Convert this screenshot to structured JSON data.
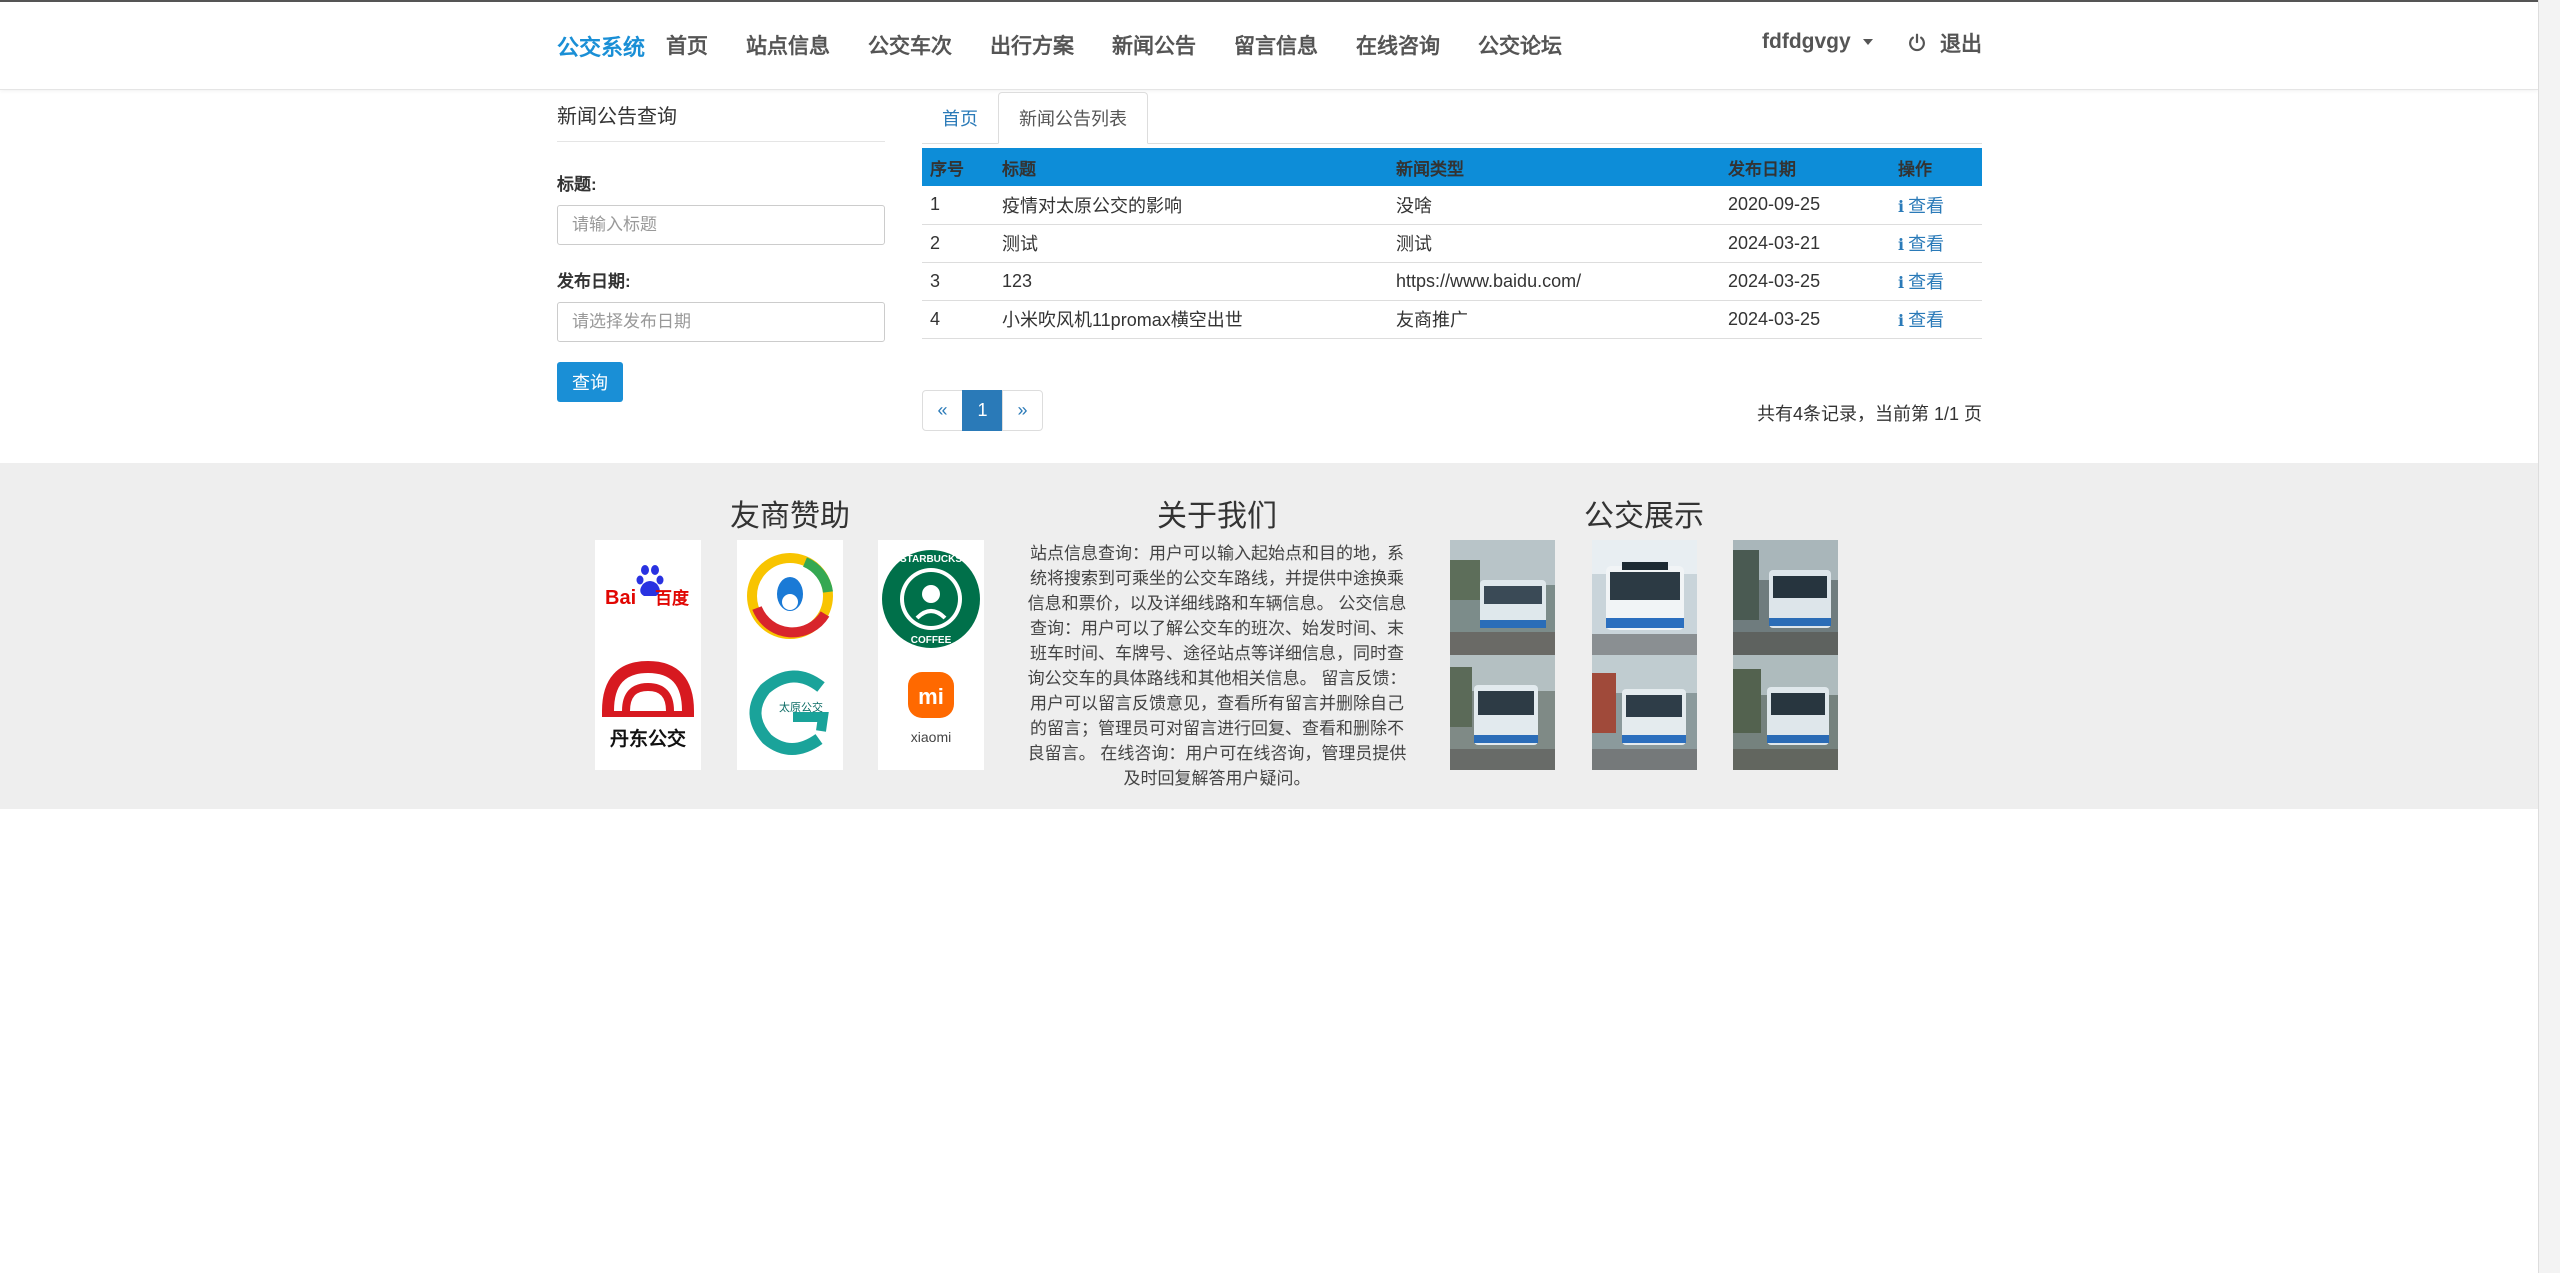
{
  "navbar": {
    "brand": "公交系统",
    "items": [
      "首页",
      "站点信息",
      "公交车次",
      "出行方案",
      "新闻公告",
      "留言信息",
      "在线咨询",
      "公交论坛"
    ],
    "username": "fdfdgvgy",
    "logout": "退出"
  },
  "search": {
    "title": "新闻公告查询",
    "title_label": "标题:",
    "title_placeholder": "请输入标题",
    "date_label": "发布日期:",
    "date_placeholder": "请选择发布日期",
    "button": "查询"
  },
  "tabs": {
    "home": "首页",
    "list": "新闻公告列表"
  },
  "table": {
    "headers": [
      "序号",
      "标题",
      "新闻类型",
      "发布日期",
      "操作"
    ],
    "view_label": "查看",
    "rows": [
      {
        "no": "1",
        "title": "疫情对太原公交的影响",
        "type": "没啥",
        "date": "2020-09-25"
      },
      {
        "no": "2",
        "title": "测试",
        "type": "测试",
        "date": "2024-03-21"
      },
      {
        "no": "3",
        "title": "123",
        "type": "https://www.baidu.com/",
        "date": "2024-03-25"
      },
      {
        "no": "4",
        "title": "小米吹风机11promax横空出世",
        "type": "友商推广",
        "date": "2024-03-25"
      }
    ]
  },
  "pagination": {
    "prev": "«",
    "current": "1",
    "next": "»",
    "info": "共有4条记录，当前第 1/1 页"
  },
  "footer": {
    "sponsors_title": "友商赞助",
    "about_title": "关于我们",
    "about_text": "站点信息查询：用户可以输入起始点和目的地，系统将搜索到可乘坐的公交车路线，并提供中途换乘信息和票价，以及详细线路和车辆信息。 公交信息查询：用户可以了解公交车的班次、始发时间、末班车时间、车牌号、途径站点等详细信息，同时查询公交车的具体路线和其他相关信息。 留言反馈：用户可以留言反馈意见，查看所有留言并删除自己的留言；管理员可对留言进行回复、查看和删除不良留言。 在线咨询：用户可在线咨询，管理员提供及时回复解答用户疑问。",
    "showcase_title": "公交展示",
    "logos": {
      "baidu": {
        "text": "Bai",
        "text2": "百度"
      },
      "dandong": {
        "text": "丹东公交"
      },
      "taiyuan": {
        "text": "太原公交"
      },
      "starbucks": {
        "text": "STARBUCKS",
        "text2": "COFFEE"
      },
      "xiaomi": {
        "text": "mi",
        "text2": "xiaomi"
      }
    }
  },
  "colors": {
    "accent": "#1a8fd6",
    "table_header": "#0d8dd8",
    "link": "#2a7ab8",
    "footer_bg": "#eeeeee"
  }
}
